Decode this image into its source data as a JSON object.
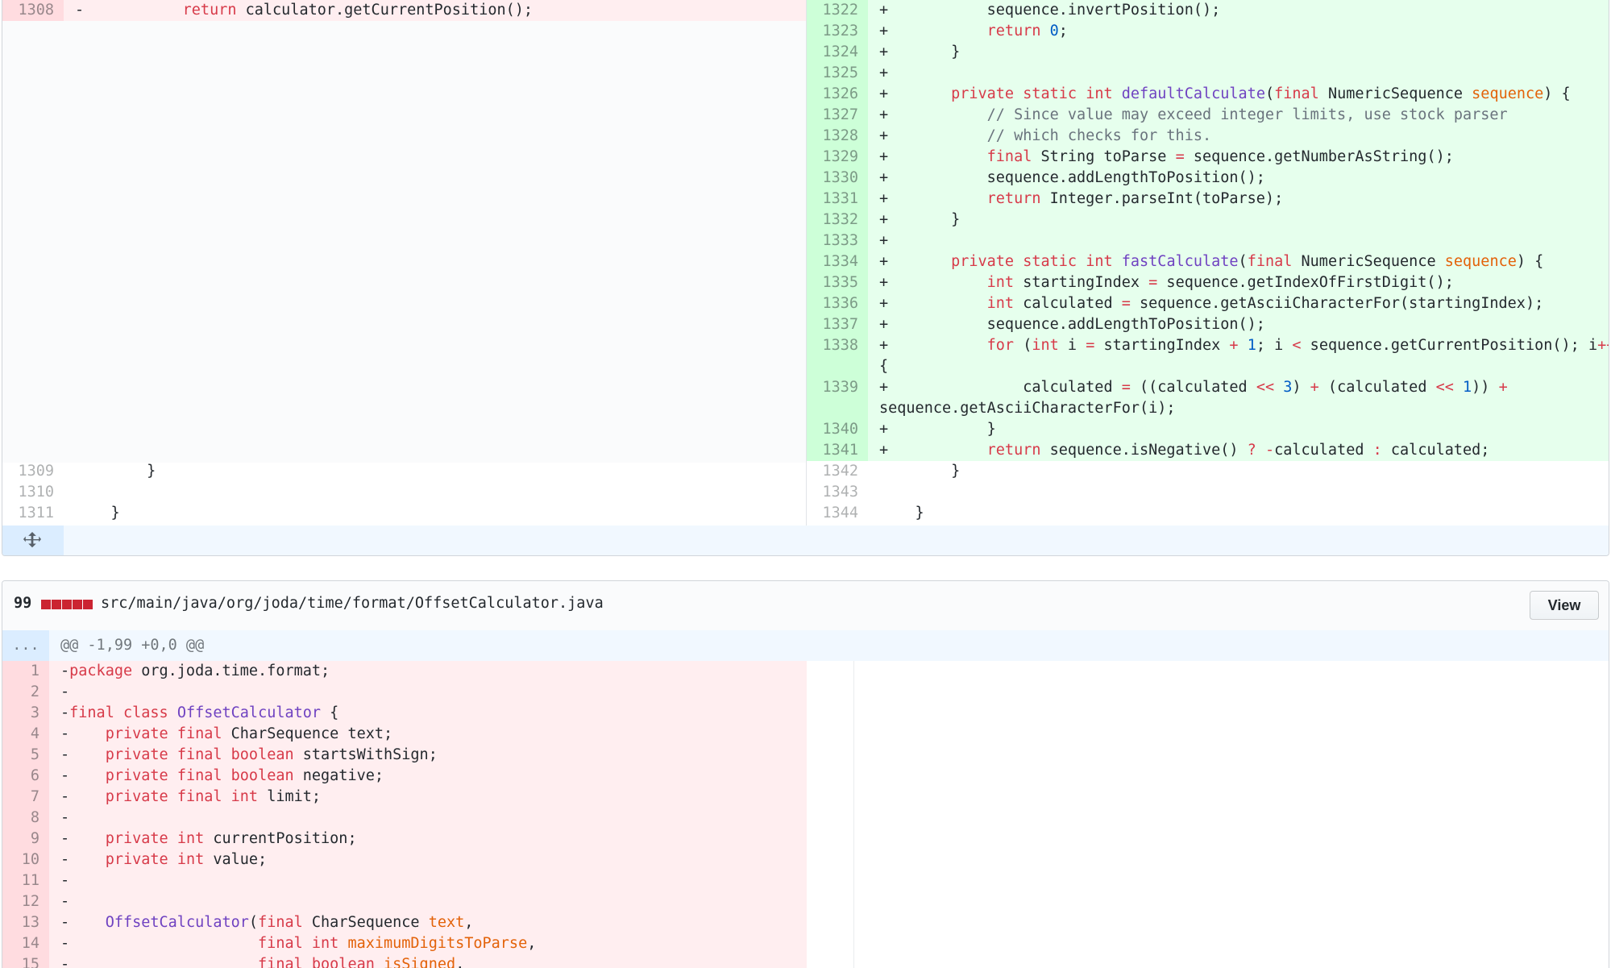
{
  "file1": {
    "left_lines": [
      {
        "num": "1308",
        "type": "del",
        "code": [
          {
            "t": "-           "
          },
          {
            "t": "return",
            "c": "k"
          },
          {
            "t": " calculator.getCurrentPosition();"
          }
        ]
      },
      {
        "num": "1309",
        "type": "ctx",
        "code": [
          {
            "t": "        }"
          }
        ]
      },
      {
        "num": "1310",
        "type": "ctx",
        "code": [
          {
            "t": ""
          }
        ]
      },
      {
        "num": "1311",
        "type": "ctx",
        "code": [
          {
            "t": "    }"
          }
        ]
      }
    ],
    "right_lines": [
      {
        "num": "1322",
        "type": "add",
        "code": [
          {
            "t": "+           sequence.invertPosition();"
          }
        ]
      },
      {
        "num": "1323",
        "type": "add",
        "code": [
          {
            "t": "+           "
          },
          {
            "t": "return",
            "c": "k"
          },
          {
            "t": " "
          },
          {
            "t": "0",
            "c": "n"
          },
          {
            "t": ";"
          }
        ]
      },
      {
        "num": "1324",
        "type": "add",
        "code": [
          {
            "t": "+       }"
          }
        ]
      },
      {
        "num": "1325",
        "type": "add",
        "code": [
          {
            "t": "+"
          }
        ]
      },
      {
        "num": "1326",
        "type": "add",
        "code": [
          {
            "t": "+       "
          },
          {
            "t": "private",
            "c": "k"
          },
          {
            "t": " "
          },
          {
            "t": "static",
            "c": "k"
          },
          {
            "t": " "
          },
          {
            "t": "int",
            "c": "k"
          },
          {
            "t": " "
          },
          {
            "t": "defaultCalculate",
            "c": "f"
          },
          {
            "t": "("
          },
          {
            "t": "final",
            "c": "k"
          },
          {
            "t": " NumericSequence "
          },
          {
            "t": "sequence",
            "c": "p"
          },
          {
            "t": ") {"
          }
        ]
      },
      {
        "num": "1327",
        "type": "add",
        "code": [
          {
            "t": "+           "
          },
          {
            "t": "// Since value may exceed integer limits, use stock parser",
            "c": "c"
          }
        ]
      },
      {
        "num": "1328",
        "type": "add",
        "code": [
          {
            "t": "+           "
          },
          {
            "t": "// which checks for this.",
            "c": "c"
          }
        ]
      },
      {
        "num": "1329",
        "type": "add",
        "code": [
          {
            "t": "+           "
          },
          {
            "t": "final",
            "c": "k"
          },
          {
            "t": " String toParse "
          },
          {
            "t": "=",
            "c": "k"
          },
          {
            "t": " sequence.getNumberAsString();"
          }
        ]
      },
      {
        "num": "1330",
        "type": "add",
        "code": [
          {
            "t": "+           sequence.addLengthToPosition();"
          }
        ]
      },
      {
        "num": "1331",
        "type": "add",
        "code": [
          {
            "t": "+           "
          },
          {
            "t": "return",
            "c": "k"
          },
          {
            "t": " Integer.parseInt(toParse);"
          }
        ]
      },
      {
        "num": "1332",
        "type": "add",
        "code": [
          {
            "t": "+       }"
          }
        ]
      },
      {
        "num": "1333",
        "type": "add",
        "code": [
          {
            "t": "+"
          }
        ]
      },
      {
        "num": "1334",
        "type": "add",
        "code": [
          {
            "t": "+       "
          },
          {
            "t": "private",
            "c": "k"
          },
          {
            "t": " "
          },
          {
            "t": "static",
            "c": "k"
          },
          {
            "t": " "
          },
          {
            "t": "int",
            "c": "k"
          },
          {
            "t": " "
          },
          {
            "t": "fastCalculate",
            "c": "f"
          },
          {
            "t": "("
          },
          {
            "t": "final",
            "c": "k"
          },
          {
            "t": " NumericSequence "
          },
          {
            "t": "sequence",
            "c": "p"
          },
          {
            "t": ") {"
          }
        ]
      },
      {
        "num": "1335",
        "type": "add",
        "code": [
          {
            "t": "+           "
          },
          {
            "t": "int",
            "c": "k"
          },
          {
            "t": " startingIndex "
          },
          {
            "t": "=",
            "c": "k"
          },
          {
            "t": " sequence.getIndexOfFirstDigit();"
          }
        ]
      },
      {
        "num": "1336",
        "type": "add",
        "code": [
          {
            "t": "+           "
          },
          {
            "t": "int",
            "c": "k"
          },
          {
            "t": " calculated "
          },
          {
            "t": "=",
            "c": "k"
          },
          {
            "t": " sequence.getAsciiCharacterFor(startingIndex);"
          }
        ]
      },
      {
        "num": "1337",
        "type": "add",
        "code": [
          {
            "t": "+           sequence.addLengthToPosition();"
          }
        ]
      },
      {
        "num": "1338",
        "type": "add",
        "code": [
          {
            "t": "+           "
          },
          {
            "t": "for",
            "c": "k"
          },
          {
            "t": " ("
          },
          {
            "t": "int",
            "c": "k"
          },
          {
            "t": " i "
          },
          {
            "t": "=",
            "c": "k"
          },
          {
            "t": " startingIndex "
          },
          {
            "t": "+",
            "c": "k"
          },
          {
            "t": " "
          },
          {
            "t": "1",
            "c": "n"
          },
          {
            "t": "; i "
          },
          {
            "t": "<",
            "c": "k"
          },
          {
            "t": " sequence.getCurrentPosition(); i"
          },
          {
            "t": "++",
            "c": "k"
          },
          {
            "t": ")"
          }
        ]
      },
      {
        "num": "",
        "type": "add",
        "code": [
          {
            "t": "{"
          }
        ]
      },
      {
        "num": "1339",
        "type": "add",
        "code": [
          {
            "t": "+               calculated "
          },
          {
            "t": "=",
            "c": "k"
          },
          {
            "t": " ((calculated "
          },
          {
            "t": "<<",
            "c": "k"
          },
          {
            "t": " "
          },
          {
            "t": "3",
            "c": "n"
          },
          {
            "t": ") "
          },
          {
            "t": "+",
            "c": "k"
          },
          {
            "t": " (calculated "
          },
          {
            "t": "<<",
            "c": "k"
          },
          {
            "t": " "
          },
          {
            "t": "1",
            "c": "n"
          },
          {
            "t": ")) "
          },
          {
            "t": "+",
            "c": "k"
          }
        ]
      },
      {
        "num": "",
        "type": "add",
        "code": [
          {
            "t": "sequence.getAsciiCharacterFor(i);"
          }
        ]
      },
      {
        "num": "1340",
        "type": "add",
        "code": [
          {
            "t": "+           }"
          }
        ]
      },
      {
        "num": "1341",
        "type": "add",
        "code": [
          {
            "t": "+           "
          },
          {
            "t": "return",
            "c": "k"
          },
          {
            "t": " sequence.isNegative() "
          },
          {
            "t": "?",
            "c": "k"
          },
          {
            "t": " "
          },
          {
            "t": "-",
            "c": "k"
          },
          {
            "t": "calculated "
          },
          {
            "t": ":",
            "c": "k"
          },
          {
            "t": " calculated;"
          }
        ]
      },
      {
        "num": "1342",
        "type": "ctx",
        "code": [
          {
            "t": "        }"
          }
        ]
      },
      {
        "num": "1343",
        "type": "ctx",
        "code": [
          {
            "t": ""
          }
        ]
      },
      {
        "num": "1344",
        "type": "ctx",
        "code": [
          {
            "t": "    }"
          }
        ]
      }
    ]
  },
  "file2": {
    "diffstat": "99",
    "diffstat_blocks": 5,
    "path": "src/main/java/org/joda/time/format/OffsetCalculator.java",
    "view_label": "View",
    "hunk_gutter": "...",
    "hunk_header": "@@ -1,99 +0,0 @@",
    "lines": [
      {
        "num": "1",
        "code": [
          {
            "t": "-"
          },
          {
            "t": "package",
            "c": "k"
          },
          {
            "t": " org.joda.time.format;"
          }
        ]
      },
      {
        "num": "2",
        "code": [
          {
            "t": "-"
          }
        ]
      },
      {
        "num": "3",
        "code": [
          {
            "t": "-"
          },
          {
            "t": "final",
            "c": "k"
          },
          {
            "t": " "
          },
          {
            "t": "class",
            "c": "k"
          },
          {
            "t": " "
          },
          {
            "t": "OffsetCalculator",
            "c": "f"
          },
          {
            "t": " {"
          }
        ]
      },
      {
        "num": "4",
        "code": [
          {
            "t": "-    "
          },
          {
            "t": "private",
            "c": "k"
          },
          {
            "t": " "
          },
          {
            "t": "final",
            "c": "k"
          },
          {
            "t": " CharSequence text;"
          }
        ]
      },
      {
        "num": "5",
        "code": [
          {
            "t": "-    "
          },
          {
            "t": "private",
            "c": "k"
          },
          {
            "t": " "
          },
          {
            "t": "final",
            "c": "k"
          },
          {
            "t": " "
          },
          {
            "t": "boolean",
            "c": "k"
          },
          {
            "t": " startsWithSign;"
          }
        ]
      },
      {
        "num": "6",
        "code": [
          {
            "t": "-    "
          },
          {
            "t": "private",
            "c": "k"
          },
          {
            "t": " "
          },
          {
            "t": "final",
            "c": "k"
          },
          {
            "t": " "
          },
          {
            "t": "boolean",
            "c": "k"
          },
          {
            "t": " negative;"
          }
        ]
      },
      {
        "num": "7",
        "code": [
          {
            "t": "-    "
          },
          {
            "t": "private",
            "c": "k"
          },
          {
            "t": " "
          },
          {
            "t": "final",
            "c": "k"
          },
          {
            "t": " "
          },
          {
            "t": "int",
            "c": "k"
          },
          {
            "t": " limit;"
          }
        ]
      },
      {
        "num": "8",
        "code": [
          {
            "t": "-"
          }
        ]
      },
      {
        "num": "9",
        "code": [
          {
            "t": "-    "
          },
          {
            "t": "private",
            "c": "k"
          },
          {
            "t": " "
          },
          {
            "t": "int",
            "c": "k"
          },
          {
            "t": " currentPosition;"
          }
        ]
      },
      {
        "num": "10",
        "code": [
          {
            "t": "-    "
          },
          {
            "t": "private",
            "c": "k"
          },
          {
            "t": " "
          },
          {
            "t": "int",
            "c": "k"
          },
          {
            "t": " value;"
          }
        ]
      },
      {
        "num": "11",
        "code": [
          {
            "t": "-"
          }
        ]
      },
      {
        "num": "12",
        "code": [
          {
            "t": "-"
          }
        ]
      },
      {
        "num": "13",
        "code": [
          {
            "t": "-    "
          },
          {
            "t": "OffsetCalculator",
            "c": "f"
          },
          {
            "t": "("
          },
          {
            "t": "final",
            "c": "k"
          },
          {
            "t": " CharSequence "
          },
          {
            "t": "text",
            "c": "p"
          },
          {
            "t": ","
          }
        ]
      },
      {
        "num": "14",
        "code": [
          {
            "t": "-                     "
          },
          {
            "t": "final",
            "c": "k"
          },
          {
            "t": " "
          },
          {
            "t": "int",
            "c": "k"
          },
          {
            "t": " "
          },
          {
            "t": "maximumDigitsToParse",
            "c": "p"
          },
          {
            "t": ","
          }
        ]
      },
      {
        "num": "15",
        "code": [
          {
            "t": "-                     "
          },
          {
            "t": "final",
            "c": "k"
          },
          {
            "t": " "
          },
          {
            "t": "boolean",
            "c": "k"
          },
          {
            "t": " "
          },
          {
            "t": "isSigned",
            "c": "p"
          },
          {
            "t": ","
          }
        ]
      }
    ]
  }
}
